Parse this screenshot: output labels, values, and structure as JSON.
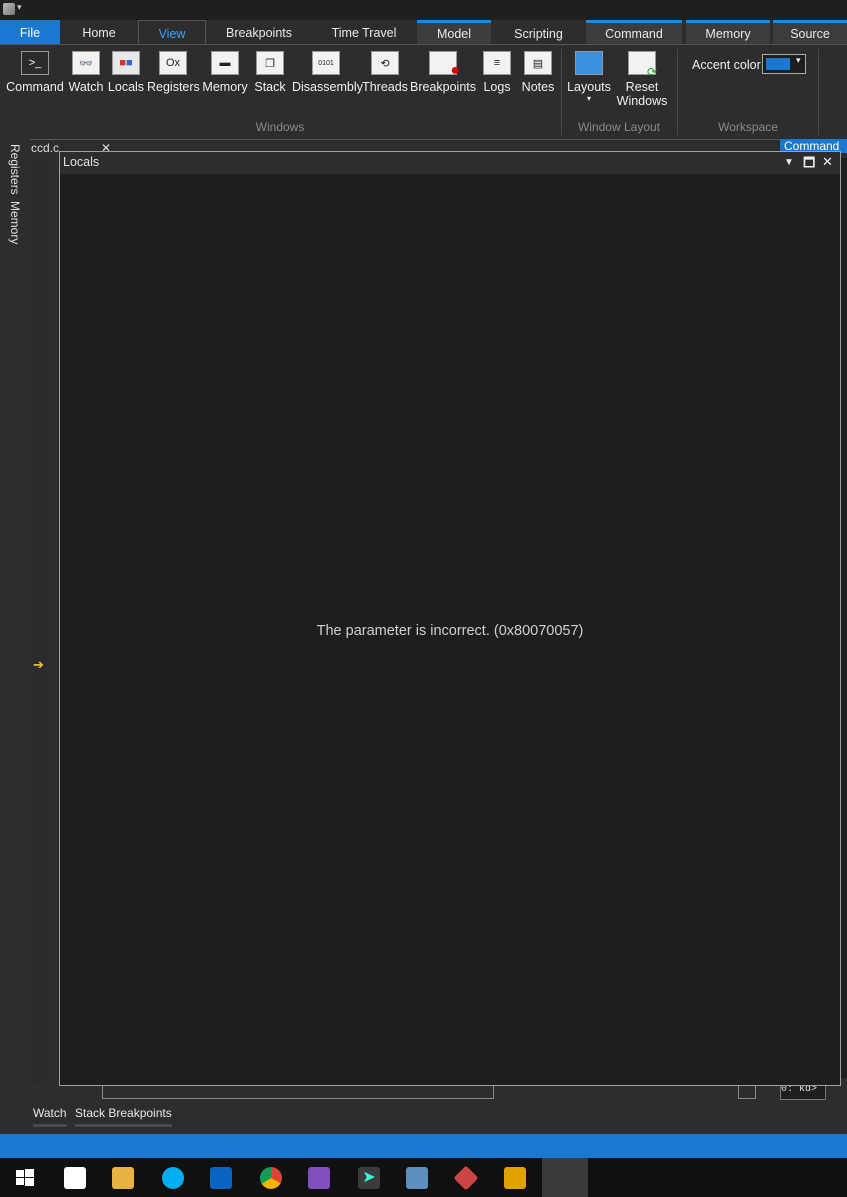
{
  "tabs": {
    "file": "File",
    "home": "Home",
    "view": "View",
    "breakpoints": "Breakpoints",
    "time_travel": "Time Travel",
    "model": "Model",
    "scripting": "Scripting",
    "command": "Command",
    "memory": "Memory",
    "source": "Source"
  },
  "ribbon": {
    "command": "Command",
    "watch": "Watch",
    "locals": "Locals",
    "registers": "Registers",
    "registers_icon_text": "Ox",
    "memory": "Memory",
    "stack": "Stack",
    "disassembly": "Disassembly",
    "threads": "Threads",
    "breakpoints": "Breakpoints",
    "logs": "Logs",
    "notes": "Notes",
    "layouts": "Layouts",
    "reset_windows_line1": "Reset",
    "reset_windows_line2": "Windows",
    "accent_color": "Accent color",
    "group_windows": "Windows",
    "group_window_layout": "Window Layout",
    "group_workspace": "Workspace"
  },
  "side_tabs": {
    "registers": "Registers",
    "memory": "Memory"
  },
  "editor": {
    "file_tab": "ccd.c",
    "command_tab": "Command",
    "prompt": "0: kd>"
  },
  "locals_window": {
    "title": "Locals",
    "message": "The parameter is incorrect. (0x80070057)"
  },
  "bottom_tabs": {
    "watch": "Watch",
    "stack_breakpoints": "Stack Breakpoints"
  },
  "colors": {
    "accent": "#1a78d0",
    "ribbon_bg": "#2d2d30",
    "window_bg": "#1e1e1e",
    "pointer": "#f5c342"
  }
}
